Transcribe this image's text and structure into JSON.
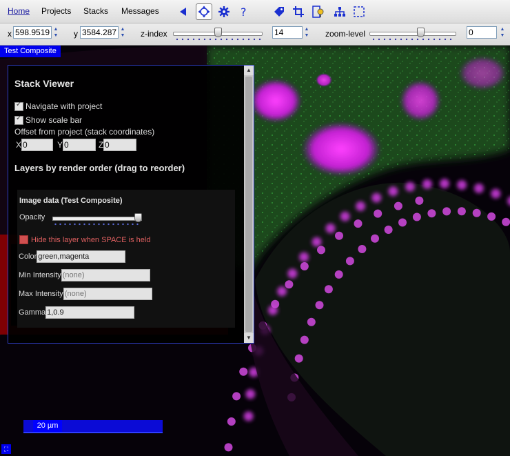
{
  "menubar": {
    "items": [
      "Home",
      "Projects",
      "Stacks",
      "Messages"
    ]
  },
  "navbar": {
    "x_label": "x",
    "x_value": "598.95193",
    "y_label": "y",
    "y_value": "3584.2874",
    "zindex_label": "z-index",
    "zindex_value": "14",
    "zindex_slider_fraction": 0.5,
    "zoom_label": "zoom-level",
    "zoom_value": "0",
    "zoom_slider_fraction": 0.6
  },
  "stack": {
    "title": "Test Composite",
    "scale_bar": "20 µm"
  },
  "panel": {
    "title": "Stack Viewer",
    "navigate_label": "Navigate with project",
    "scalebar_label": "Show scale bar",
    "offset_label": "Offset from project (stack coordinates)",
    "offset": {
      "x_label": "X",
      "x": "0",
      "y_label": "Y",
      "y": "0",
      "z_label": "Z",
      "z": "0"
    },
    "layers_title": "Layers by render order (drag to reorder)",
    "layer": {
      "title": "Image data (Test Composite)",
      "opacity_label": "Opacity",
      "opacity_fraction": 1.0,
      "hide_label": "Hide this layer when SPACE is held",
      "color_label": "Color",
      "color_value": "green,magenta",
      "min_label": "Min Intensity",
      "min_placeholder": "(none)",
      "max_label": "Max Intensity",
      "max_placeholder": "(none)",
      "gamma_label": "Gamma",
      "gamma_value": "1,0.9"
    }
  },
  "colors": {
    "accent_blue": "#0000ee",
    "highlight_red": "#960000",
    "green_channel": "#1f9a28",
    "magenta_channel": "#d020e0"
  },
  "icons": [
    "back-arrow-icon",
    "navigate-move-icon",
    "settings-gear-icon",
    "help-icon",
    "tag-icon",
    "crop-icon",
    "tracing-icon",
    "tree-icon",
    "roi-select-icon"
  ]
}
